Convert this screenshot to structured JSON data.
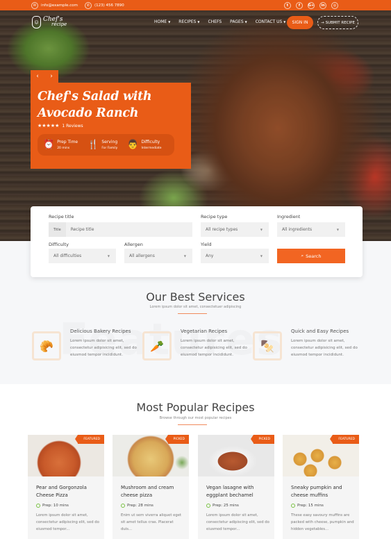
{
  "topbar": {
    "email": "info@example.com",
    "phone": "(123) 456 7890",
    "email_icon": "envelope-icon",
    "phone_icon": "phone-icon",
    "social": [
      {
        "name": "twitter-icon",
        "glyph": "t"
      },
      {
        "name": "facebook-icon",
        "glyph": "f"
      },
      {
        "name": "google-plus-icon",
        "glyph": "G+"
      },
      {
        "name": "linkedin-icon",
        "glyph": "in"
      },
      {
        "name": "dribbble-icon",
        "glyph": "◎"
      }
    ]
  },
  "nav": {
    "logo_line1": "Chef's",
    "logo_line2": "recipe",
    "items": [
      {
        "label": "HOME",
        "caret": "▼"
      },
      {
        "label": "RECIPES",
        "caret": "▼"
      },
      {
        "label": "CHEFS",
        "caret": ""
      },
      {
        "label": "PAGES",
        "caret": "▼"
      },
      {
        "label": "CONTACT US",
        "caret": "▼"
      }
    ],
    "signin": "SIGN IN",
    "submit": "SUBMIT RECIPE",
    "submit_arrow": "→"
  },
  "hero": {
    "prev": "‹",
    "next": "›",
    "title": "Chef's Salad with Avocado Ranch",
    "stars": "★★★★★",
    "rating": 5,
    "reviews": "1 Reviews",
    "meta": [
      {
        "icon": "alarm-clock-icon",
        "glyph": "⏰",
        "label": "Prep Time",
        "value": "20 mins"
      },
      {
        "icon": "utensils-icon",
        "glyph": "🍴",
        "label": "Serving",
        "value": "For Family"
      },
      {
        "icon": "chef-icon",
        "glyph": "👨",
        "label": "Difficulty",
        "value": "Intermediate"
      }
    ]
  },
  "search": {
    "title_label": "Recipe title",
    "title_prefix": "Title",
    "title_placeholder": "Recipe title",
    "type_label": "Recipe type",
    "type_value": "All recipe types",
    "ingredient_label": "Ingredient",
    "ingredient_value": "All ingredients",
    "difficulty_label": "Difficulty",
    "difficulty_value": "All difficulties",
    "allergen_label": "Allergen",
    "allergen_value": "All allergens",
    "yield_label": "Yield",
    "yield_value": "Any",
    "button": "Search",
    "caret": "▼"
  },
  "services": {
    "title": "Our Best Services",
    "subtitle": "Lorem ipsum dolor sit amet, consectetuer adipiscing",
    "bg_word": "Features",
    "items": [
      {
        "title": "Delicious Bakery Recipes",
        "text": "Lorem ipsum dolor sit amet, consectetur adipisicing elit, sed do eiusmod tempor incididunt.",
        "icon": "bread-jar-icon",
        "glyph": "🥐"
      },
      {
        "title": "Vegetarian Recipes",
        "text": "Lorem ipsum dolor sit amet, consectetur adipisicing elit, sed do eiusmod tempor incididunt.",
        "icon": "vegetable-crate-icon",
        "glyph": "🥕"
      },
      {
        "title": "Quick and Easy Recipes",
        "text": "Lorem ipsum dolor sit amet, consectetur adipisicing elit, sed do eiusmod tempor incididunt.",
        "icon": "skewer-icon",
        "glyph": "🍢"
      }
    ]
  },
  "popular": {
    "title": "Most Popular Recipes",
    "subtitle": "Browse through our most popular recipes",
    "cards": [
      {
        "badge": "FEATURED",
        "title": "Pear and Gorgonzola Cheese Pizza",
        "prep": "Prep: 10 mins",
        "text": "Lorem ipsum dolor sit amet, consectetur adipiscing elit, sed do eiusmod tempor..."
      },
      {
        "badge": "PICKED",
        "title": "Mushroom and cream cheese pizza",
        "prep": "Prep: 28 mins",
        "text": "Enim ut sem viverra aliquet eget sit amet tellus cras. Placerat duis..."
      },
      {
        "badge": "PICKED",
        "title": "Vegan lasagne with eggplant bechamel",
        "prep": "Prep: 25 mins",
        "text": "Lorem ipsum dolor sit amet, consectetur adipiscing elit, sed do eiusmod tempor..."
      },
      {
        "badge": "FEATURED",
        "title": "Sneaky pumpkin and cheese muffins",
        "prep": "Prep: 15 mins",
        "text": "These easy savoury muffins are packed with cheese, pumpkin and hidden vegetables..."
      }
    ]
  },
  "colors": {
    "accent": "#e95c17",
    "search_button": "#f26522",
    "prep_icon": "#7ac143"
  }
}
